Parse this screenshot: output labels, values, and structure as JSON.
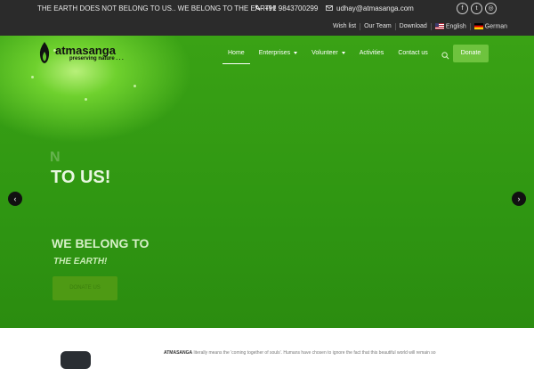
{
  "topbar": {
    "tagline": "THE EARTH DOES NOT BELONG TO US.. WE BELONG TO THE EARTH!",
    "phone": "+91 9843700299",
    "email": "udhay@atmasanga.com",
    "social": [
      {
        "icon": "facebook-icon",
        "glyph": "f"
      },
      {
        "icon": "twitter-icon",
        "glyph": "t"
      },
      {
        "icon": "instagram-icon",
        "glyph": "◎"
      }
    ],
    "links": [
      "Wish list",
      "Our Team",
      "Download"
    ],
    "languages": [
      "English",
      "German"
    ]
  },
  "brand": {
    "name": "atmasanga",
    "tagline": "preserving nature . . ."
  },
  "nav": {
    "items": [
      {
        "label": "Home",
        "active": true
      },
      {
        "label": "Enterprises",
        "dropdown": true
      },
      {
        "label": "Volunteer",
        "dropdown": true
      },
      {
        "label": "Activities"
      },
      {
        "label": "Contact us"
      }
    ],
    "donate": "Donate"
  },
  "hero": {
    "faint_text": "N",
    "line1": "TO US!",
    "line2": "WE BELONG TO",
    "line3": "THE EARTH!",
    "button": "DONATE US"
  },
  "about": {
    "brand": "ATMASANGA",
    "text": " literally means the 'coming together of souls'. Humans have chosen to ignore the fact that this beautiful world will remain so"
  },
  "colors": {
    "accent": "#6ec33e",
    "topbar_bg": "#2b2b2b",
    "hero_green": "#2f9612"
  }
}
